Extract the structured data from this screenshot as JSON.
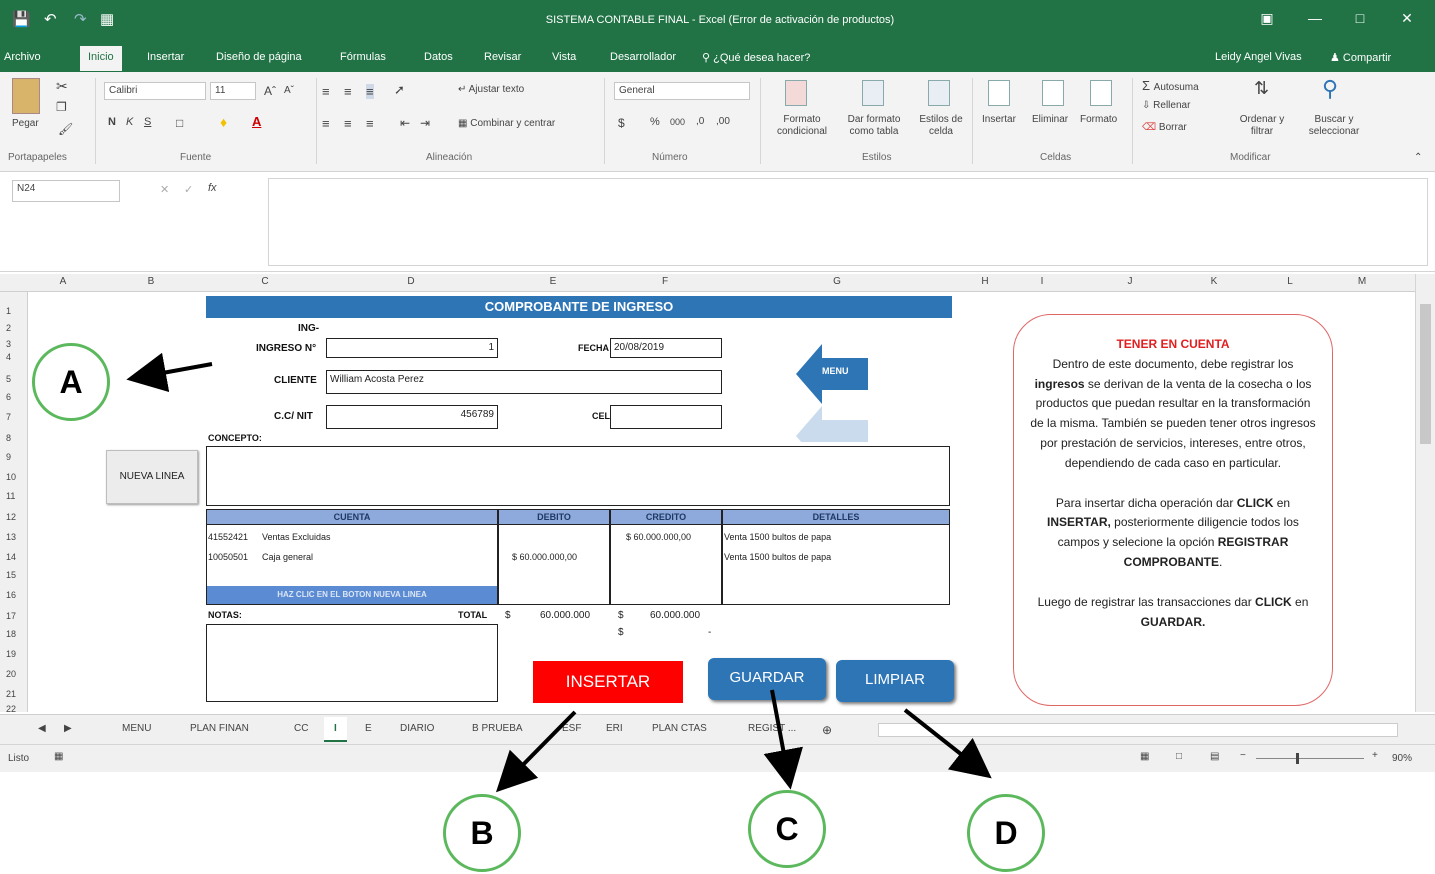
{
  "window": {
    "title": "SISTEMA CONTABLE FINAL - Excel (Error de activación de productos)",
    "user": "Leidy Angel Vivas",
    "share": "Compartir"
  },
  "ribbon_tabs": [
    "Archivo",
    "Inicio",
    "Insertar",
    "Diseño de página",
    "Fórmulas",
    "Datos",
    "Revisar",
    "Vista",
    "Desarrollador",
    "¿Qué desea hacer?"
  ],
  "ribbon": {
    "paste": "Pegar",
    "font_name": "Calibri",
    "font_size": "11",
    "wrap_text": "Ajustar texto",
    "merge_center": "Combinar y centrar",
    "number_format": "General",
    "conditional_format": "Formato condicional",
    "format_table": "Dar formato como tabla",
    "cell_styles": "Estilos de celda",
    "insert": "Insertar",
    "delete": "Eliminar",
    "format": "Formato",
    "autosum": "Autosuma",
    "fill": "Rellenar",
    "clear": "Borrar",
    "sort_filter": "Ordenar y filtrar",
    "find_select": "Buscar y seleccionar",
    "groups": [
      "Portapapeles",
      "Fuente",
      "Alineación",
      "Número",
      "Estilos",
      "Celdas",
      "Modificar"
    ]
  },
  "formula_bar": {
    "name_box": "N24",
    "fx": "fx",
    "content": ""
  },
  "columns": [
    "A",
    "B",
    "C",
    "D",
    "E",
    "F",
    "G",
    "H",
    "I",
    "J",
    "K",
    "L",
    "M"
  ],
  "rows": [
    "1",
    "2",
    "3",
    "4",
    "5",
    "6",
    "7",
    "8",
    "9",
    "10",
    "11",
    "12",
    "13",
    "14",
    "15",
    "16",
    "17",
    "18",
    "19",
    "20",
    "21",
    "22"
  ],
  "form": {
    "title": "COMPROBANTE DE INGRESO",
    "ing_label": "ING-",
    "ingreso_label": "INGRESO N°",
    "ingreso_value": "1",
    "fecha_label": "FECHA",
    "fecha_value": "20/08/2019",
    "cliente_label": "CLIENTE",
    "cliente_value": "William Acosta Perez",
    "nit_label": "C.C/ NIT",
    "nit_value": "456789",
    "cel_label": "CEL",
    "cel_value": "",
    "concepto_label": "CONCEPTO:",
    "menu_button": "MENU",
    "nueva_linea_button": "NUEVA LINEA",
    "table_headers": [
      "CUENTA",
      "DEBITO",
      "CREDITO",
      "DETALLES"
    ],
    "table_rows": [
      {
        "code": "41552421",
        "name": "Ventas Excluidas",
        "debito": "",
        "credito": "$ 60.000.000,00",
        "detalle": "Venta 1500 bultos de papa"
      },
      {
        "code": "10050501",
        "name": "Caja general",
        "debito": "$ 60.000.000,00",
        "credito": "",
        "detalle": "Venta 1500 bultos de papa"
      }
    ],
    "haz_clic_hint": "HAZ CLIC EN EL BOTON NUEVA LINEA",
    "notas_label": "NOTAS:",
    "total_label": "TOTAL",
    "total_debito_symbol": "$",
    "total_debito_value": "60.000.000",
    "total_credito_symbol": "$",
    "total_credito_value": "60.000.000",
    "dash_symbol": "$",
    "dash_value": "-",
    "insertar_button": "INSERTAR",
    "guardar_button": "GUARDAR",
    "limpiar_button": "LIMPIAR"
  },
  "note": {
    "title": "TENER EN CUENTA",
    "p1_a": "Dentro de este documento, debe registrar los ",
    "p1_b": "ingresos",
    "p1_c": " se derivan de la venta de la cosecha o los productos que puedan resultar en la transformación de la misma. También se pueden tener otros ingresos por prestación de servicios, intereses, entre otros, dependiendo de cada caso en particular.",
    "p2_a": "Para insertar dicha operación dar ",
    "p2_b": "CLICK",
    "p2_c": " en ",
    "p2_d": "INSERTAR,",
    "p2_e": " posteriormente diligencie todos los campos y selecione la opción ",
    "p2_f": "REGISTRAR COMPROBANTE",
    "p2_g": ".",
    "p3_a": "Luego de registrar las transacciones dar ",
    "p3_b": "CLICK",
    "p3_c": " en ",
    "p3_d": "GUARDAR."
  },
  "sheet_tabs": [
    "MENU",
    "PLAN FINAN",
    "CC",
    "I",
    "E",
    "DIARIO",
    "B PRUEBA",
    "ESF",
    "ERI",
    "PLAN CTAS",
    "REGIST ..."
  ],
  "active_sheet": "I",
  "status": {
    "ready": "Listo",
    "zoom": "90%"
  },
  "callouts": [
    "A",
    "B",
    "C",
    "D"
  ],
  "colors": {
    "excel_green": "#217346",
    "banner_blue": "#2e75b6",
    "header_blue": "#8ea9db",
    "insert_red": "#ff0000",
    "note_border": "#e06666",
    "callout_green": "#5cb85c"
  }
}
